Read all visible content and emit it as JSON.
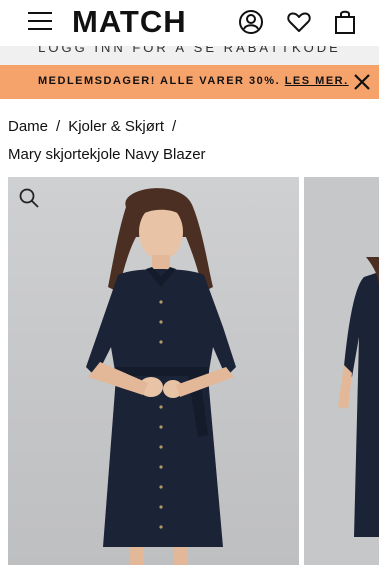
{
  "header": {
    "logo": "MATCH",
    "icons": [
      "menu-icon",
      "account-icon",
      "heart-icon",
      "cart-icon"
    ]
  },
  "promo_partial": "LOGG INN FOR Å SE RABATTKODE",
  "banner": {
    "text": "MEDLEMSDAGER! ALLE VARER 30%.",
    "link": "LES MER.",
    "color": "#f6a26b"
  },
  "breadcrumb": {
    "items": [
      "Dame",
      "Kjoler & Skjørt"
    ],
    "separator": "/"
  },
  "product": {
    "name": "Mary skjortekjole Navy Blazer",
    "dress_color": "#1b2336"
  }
}
